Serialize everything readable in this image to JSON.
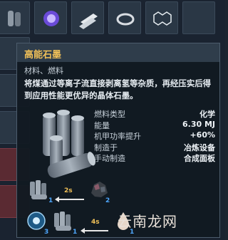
{
  "item": {
    "name": "高能石墨",
    "category": "材料、燃料",
    "description": "将煤通过等离子流直接剥离氢等杂质，再经压实后得到应用性能更优异的晶体石墨。",
    "icon": "graphite-rods-icon"
  },
  "stats": [
    {
      "label": "燃料类型",
      "value": "化学"
    },
    {
      "label": "能量",
      "value": "6.30 MJ"
    },
    {
      "label": "机甲功率提升",
      "value": "+60%"
    },
    {
      "label": "制造于",
      "value": "冶炼设备"
    },
    {
      "label": "手动制造",
      "value": "合成面板"
    }
  ],
  "recipes": [
    {
      "time": "2s",
      "output_count": "1",
      "input_count": "2",
      "output_icon": "graphite-rods-icon",
      "input_icon": "coal-ore-icon"
    },
    {
      "time": "4s",
      "outputs": [
        {
          "count": "3",
          "icon": "hydrogen-icon"
        },
        {
          "count": "1",
          "icon": "graphite-rods-icon"
        }
      ],
      "input_count": "1",
      "input_icon": "oil-drop-icon"
    }
  ],
  "watermark": "云南龙网",
  "colors": {
    "title": "#f0c058",
    "count": "#4fa8ff",
    "time": "#f0c058",
    "panel": "#121a22"
  }
}
